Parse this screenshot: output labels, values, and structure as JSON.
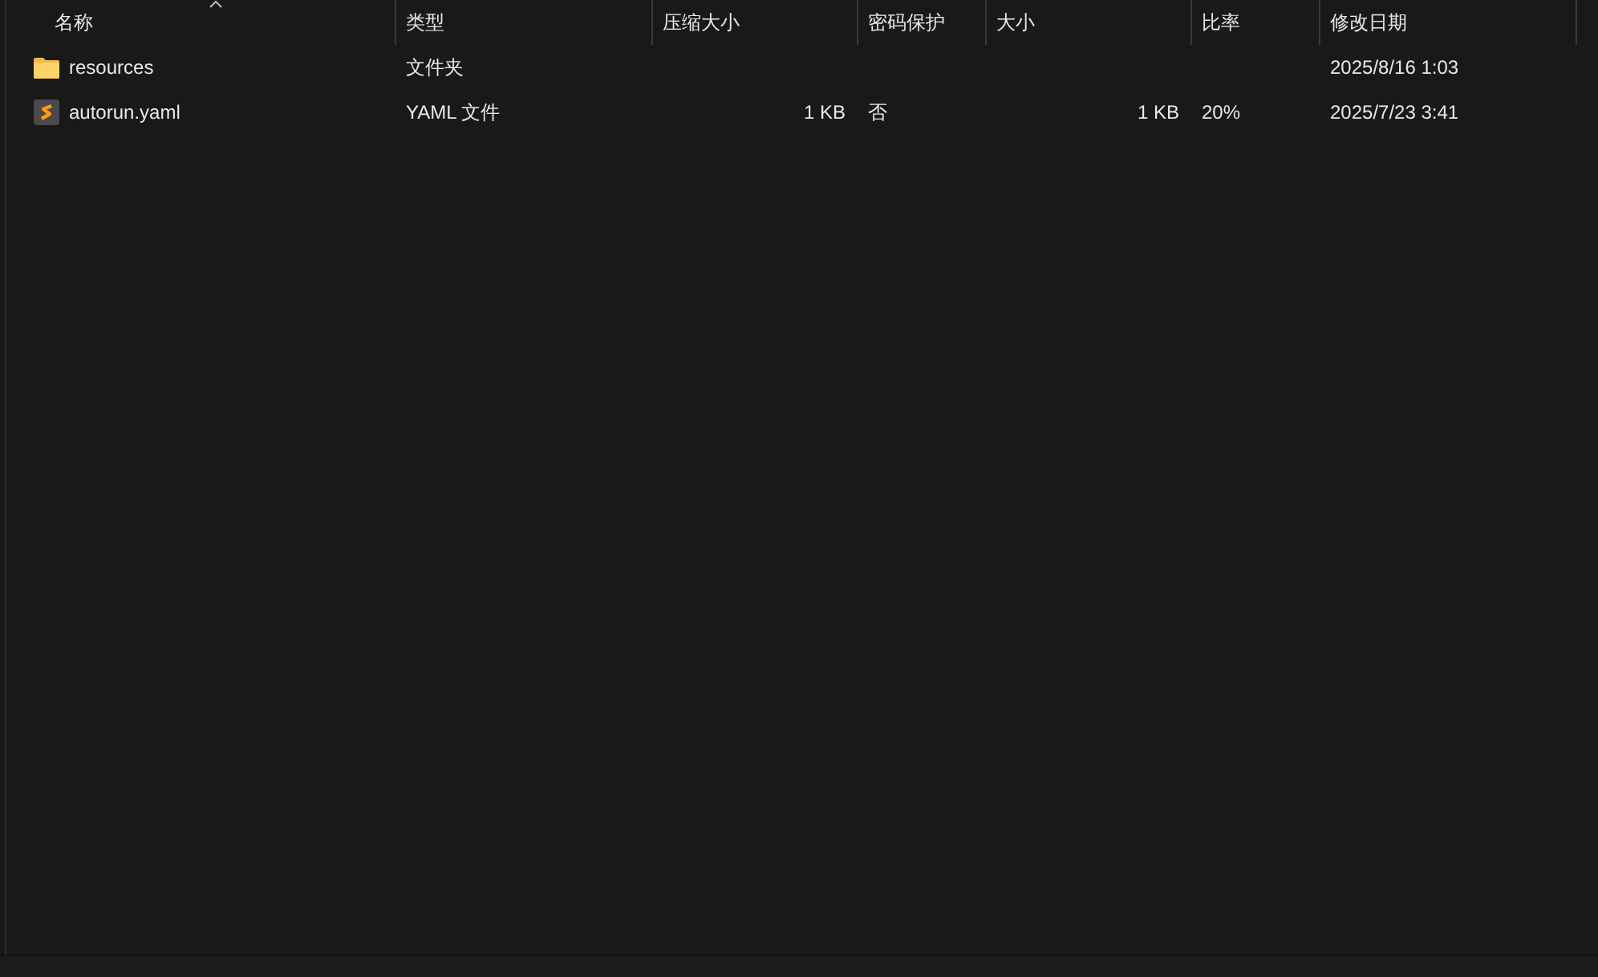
{
  "columns": [
    {
      "label": "名称",
      "sorted": true
    },
    {
      "label": "类型",
      "sorted": false
    },
    {
      "label": "压缩大小",
      "sorted": false
    },
    {
      "label": "密码保护",
      "sorted": false
    },
    {
      "label": "大小",
      "sorted": false
    },
    {
      "label": "比率",
      "sorted": false
    },
    {
      "label": "修改日期",
      "sorted": false
    }
  ],
  "rows": [
    {
      "kind": "folder",
      "cells": [
        "resources",
        "文件夹",
        "",
        "",
        "",
        "",
        "2025/8/16 1:03"
      ]
    },
    {
      "kind": "file",
      "cells": [
        "autorun.yaml",
        "YAML 文件",
        "1 KB",
        "否",
        "1 KB",
        "20%",
        "2025/7/23 3:41"
      ]
    }
  ]
}
